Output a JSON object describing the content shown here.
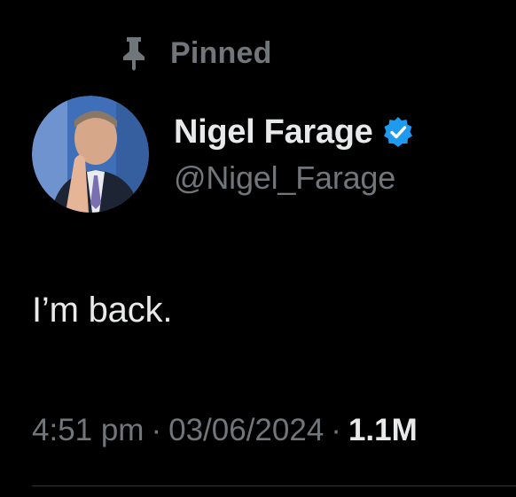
{
  "pinned": {
    "label": "Pinned",
    "icon": "pin-icon"
  },
  "author": {
    "display_name": "Nigel Farage",
    "handle": "@Nigel_Farage",
    "verified": true,
    "verified_icon": "verified-badge-icon",
    "avatar_icon": "avatar"
  },
  "tweet": {
    "text": "I’m back."
  },
  "meta": {
    "time": "4:51 pm",
    "separator": "·",
    "date": "03/06/2024",
    "views": "1.1M"
  },
  "colors": {
    "background": "#000000",
    "primary_text": "#e7e9ea",
    "secondary_text": "#71767b",
    "verified_blue": "#1d9bf0"
  }
}
